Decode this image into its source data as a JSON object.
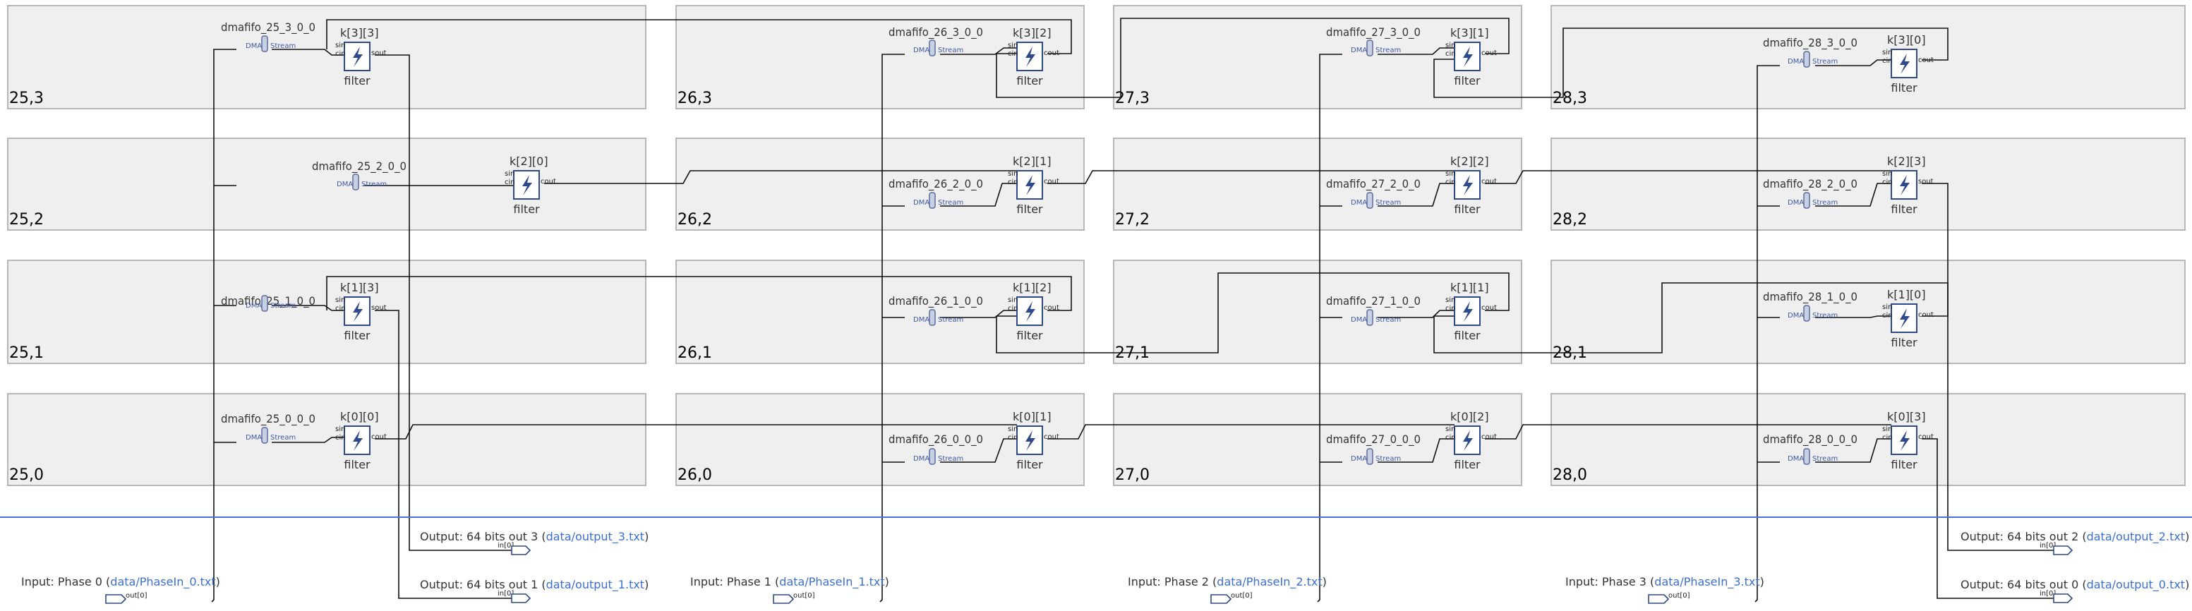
{
  "tiles": [
    {
      "label": "25,3"
    },
    {
      "label": "26,3"
    },
    {
      "label": "27,3"
    },
    {
      "label": "28,3"
    },
    {
      "label": "25,2"
    },
    {
      "label": "26,2"
    },
    {
      "label": "27,2"
    },
    {
      "label": "28,2"
    },
    {
      "label": "25,1"
    },
    {
      "label": "26,1"
    },
    {
      "label": "27,1"
    },
    {
      "label": "28,1"
    },
    {
      "label": "25,0"
    },
    {
      "label": "26,0"
    },
    {
      "label": "27,0"
    },
    {
      "label": "28,0"
    }
  ],
  "kernels": [
    {
      "name": "k[3][3]",
      "type": "filter"
    },
    {
      "name": "k[3][2]",
      "type": "filter"
    },
    {
      "name": "k[3][1]",
      "type": "filter"
    },
    {
      "name": "k[3][0]",
      "type": "filter"
    },
    {
      "name": "k[2][0]",
      "type": "filter"
    },
    {
      "name": "k[2][1]",
      "type": "filter"
    },
    {
      "name": "k[2][2]",
      "type": "filter"
    },
    {
      "name": "k[2][3]",
      "type": "filter"
    },
    {
      "name": "k[1][3]",
      "type": "filter"
    },
    {
      "name": "k[1][2]",
      "type": "filter"
    },
    {
      "name": "k[1][1]",
      "type": "filter"
    },
    {
      "name": "k[1][0]",
      "type": "filter"
    },
    {
      "name": "k[0][0]",
      "type": "filter"
    },
    {
      "name": "k[0][1]",
      "type": "filter"
    },
    {
      "name": "k[0][2]",
      "type": "filter"
    },
    {
      "name": "k[0][3]",
      "type": "filter"
    }
  ],
  "ports": {
    "sin": "sin",
    "cin": "cin",
    "cout": "cout",
    "sout": "sout"
  },
  "fifos": [
    {
      "name": "dmafifo_25_3_0_0"
    },
    {
      "name": "dmafifo_26_3_0_0"
    },
    {
      "name": "dmafifo_27_3_0_0"
    },
    {
      "name": "dmafifo_28_3_0_0"
    },
    {
      "name": "dmafifo_25_2_0_0"
    },
    {
      "name": "dmafifo_26_2_0_0"
    },
    {
      "name": "dmafifo_27_2_0_0"
    },
    {
      "name": "dmafifo_28_2_0_0"
    },
    {
      "name": "dmafifo_25_1_0_0"
    },
    {
      "name": "dmafifo_26_1_0_0"
    },
    {
      "name": "dmafifo_27_1_0_0"
    },
    {
      "name": "dmafifo_28_1_0_0"
    },
    {
      "name": "dmafifo_25_0_0_0"
    },
    {
      "name": "dmafifo_26_0_0_0"
    },
    {
      "name": "dmafifo_27_0_0_0"
    },
    {
      "name": "dmafifo_28_0_0_0"
    }
  ],
  "fifo_labels": {
    "dma": "DMA",
    "stream": "Stream"
  },
  "inputs": [
    {
      "label": "Input: Phase 0",
      "file": "data/PhaseIn_0.txt",
      "port": "out[0]"
    },
    {
      "label": "Input: Phase 1",
      "file": "data/PhaseIn_1.txt",
      "port": "out[0]"
    },
    {
      "label": "Input: Phase 2",
      "file": "data/PhaseIn_2.txt",
      "port": "out[0]"
    },
    {
      "label": "Input: Phase 3",
      "file": "data/PhaseIn_3.txt",
      "port": "out[0]"
    }
  ],
  "outputs": [
    {
      "label": "Output: 64 bits out 3",
      "file": "data/output_3.txt",
      "port": "in[0]"
    },
    {
      "label": "Output: 64 bits out 1",
      "file": "data/output_1.txt",
      "port": "in[0]"
    },
    {
      "label": "Output: 64 bits out 2",
      "file": "data/output_2.txt",
      "port": "in[0]"
    },
    {
      "label": "Output: 64 bits out 0",
      "file": "data/output_0.txt",
      "port": "in[0]"
    }
  ],
  "colors": {
    "tile_fill": "#efefef",
    "kernel_border": "#2f4a8c",
    "divider": "#4a6fd8",
    "link": "#3b6fd4"
  }
}
